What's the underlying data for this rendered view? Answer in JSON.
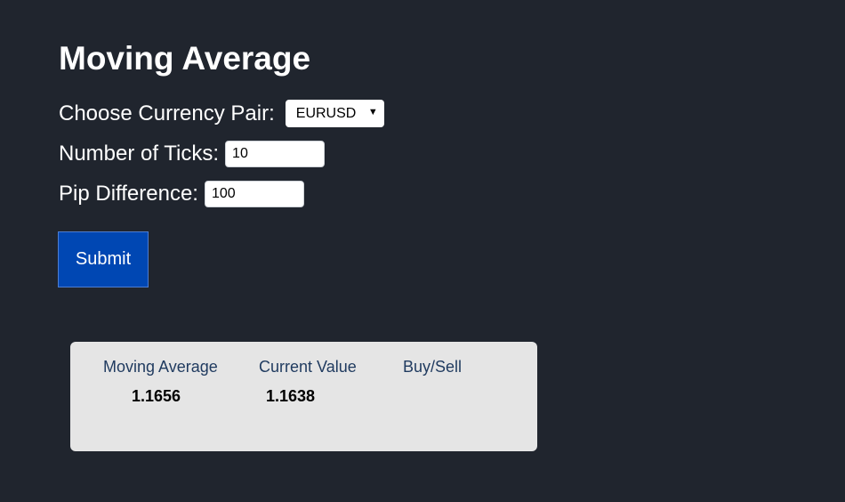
{
  "page": {
    "title": "Moving Average"
  },
  "form": {
    "currency_label": "Choose Currency Pair:",
    "currency_selected": "EURUSD",
    "currency_arrow": "▼",
    "ticks_label": "Number of Ticks:",
    "ticks_value": "10",
    "pip_label": "Pip Difference:",
    "pip_value": "100",
    "submit_label": "Submit"
  },
  "results": {
    "headers": [
      "Moving Average",
      "Current Value",
      "Buy/Sell"
    ],
    "values": [
      "1.1656",
      "1.1638",
      ""
    ]
  },
  "colors": {
    "background": "#20252e",
    "button": "#0047b3",
    "panel": "#e5e5e5",
    "header_text": "#1f3a5f"
  }
}
